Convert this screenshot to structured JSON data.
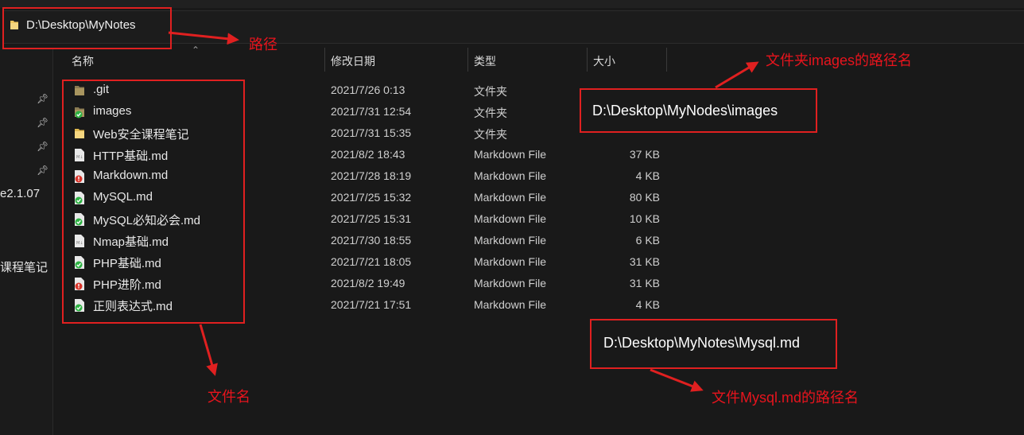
{
  "address_bar": {
    "path": "D:\\Desktop\\MyNotes"
  },
  "sidebar": {
    "items": [
      {
        "label": "e2.1.07"
      },
      {
        "label": "课程笔记"
      }
    ]
  },
  "columns": {
    "name": "名称",
    "date": "修改日期",
    "type": "类型",
    "size": "大小"
  },
  "files": [
    {
      "name": ".git",
      "date": "2021/7/26 0:13",
      "type": "文件夹",
      "size": "",
      "icon": "folder-icon"
    },
    {
      "name": "images",
      "date": "2021/7/31 12:54",
      "type": "文件夹",
      "size": "",
      "icon": "folder-synced-icon"
    },
    {
      "name": "Web安全课程笔记",
      "date": "2021/7/31 15:35",
      "type": "文件夹",
      "size": "",
      "icon": "folder-icon"
    },
    {
      "name": "HTTP基础.md",
      "date": "2021/8/2 18:43",
      "type": "Markdown File",
      "size": "37 KB",
      "icon": "markdown-file-icon"
    },
    {
      "name": "Markdown.md",
      "date": "2021/7/28 18:19",
      "type": "Markdown File",
      "size": "4 KB",
      "icon": "markdown-file-error-icon"
    },
    {
      "name": "MySQL.md",
      "date": "2021/7/25 15:32",
      "type": "Markdown File",
      "size": "80 KB",
      "icon": "markdown-file-synced-icon"
    },
    {
      "name": "MySQL必知必会.md",
      "date": "2021/7/25 15:31",
      "type": "Markdown File",
      "size": "10 KB",
      "icon": "markdown-file-synced-icon"
    },
    {
      "name": "Nmap基础.md",
      "date": "2021/7/30 18:55",
      "type": "Markdown File",
      "size": "6 KB",
      "icon": "markdown-file-icon"
    },
    {
      "name": "PHP基础.md",
      "date": "2021/7/21 18:05",
      "type": "Markdown File",
      "size": "31 KB",
      "icon": "markdown-file-synced-icon"
    },
    {
      "name": "PHP进阶.md",
      "date": "2021/8/2 19:49",
      "type": "Markdown File",
      "size": "31 KB",
      "icon": "markdown-file-error-icon"
    },
    {
      "name": "正则表达式.md",
      "date": "2021/7/21 17:51",
      "type": "Markdown File",
      "size": "4 KB",
      "icon": "markdown-file-synced-icon"
    }
  ],
  "annotations": {
    "path_label": "路径",
    "file_name_label": "文件名",
    "images_path_label": "文件夹images的路径名",
    "images_path_value": "D:\\Desktop\\MyNodes\\images",
    "mysql_path_label": "文件Mysql.md的路径名",
    "mysql_path_value": "D:\\Desktop\\MyNotes\\Mysql.md"
  },
  "colors": {
    "annotation": "#e02020",
    "background": "#191919",
    "folder": "#f0c75e",
    "synced": "#2fb344",
    "error": "#d9352b"
  }
}
